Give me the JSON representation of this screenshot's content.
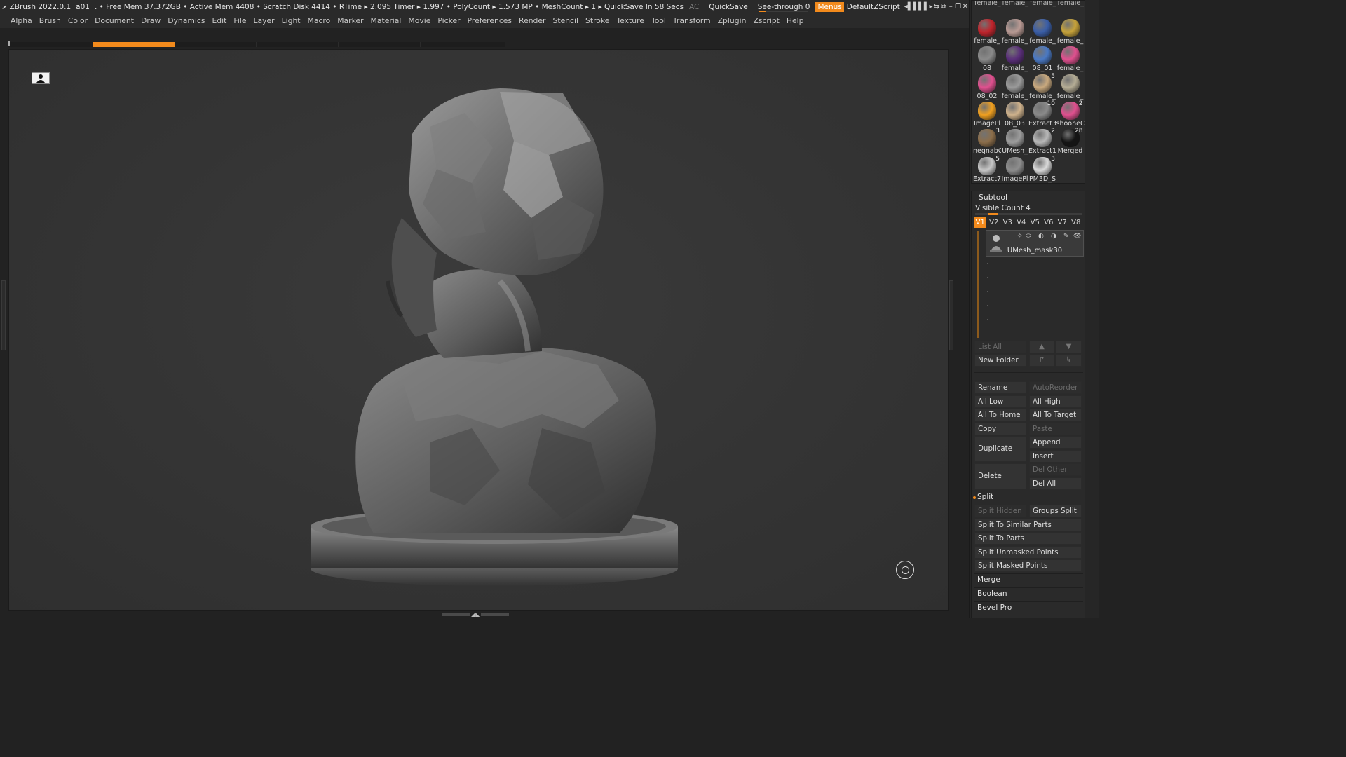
{
  "titlebar": {
    "app": "ZBrush 2022.0.1",
    "doc": "a01",
    "status": ". • Free Mem 37.372GB • Active Mem 4408 • Scratch Disk 4414 •  RTime ▸ 2.095 Timer ▸ 1.997 • PolyCount ▸ 1.573 MP  • MeshCount ▸ 1   ▸ QuickSave In 58 Secs",
    "ac": "AC",
    "quicksave": "QuickSave",
    "seethrough_label": "See-through",
    "seethrough_value": "0",
    "menus": "Menus",
    "script": "DefaultZScript"
  },
  "menubar": [
    "Alpha",
    "Brush",
    "Color",
    "Document",
    "Draw",
    "Dynamics",
    "Edit",
    "File",
    "Layer",
    "Light",
    "Macro",
    "Marker",
    "Material",
    "Movie",
    "Picker",
    "Preferences",
    "Render",
    "Stencil",
    "Stroke",
    "Texture",
    "Tool",
    "Transform",
    "Zplugin",
    "Zscript",
    "Help"
  ],
  "tools": [
    {
      "label": "female_",
      "color": "#c0242c",
      "count": ""
    },
    {
      "label": "female_",
      "color": "#b99a94",
      "count": ""
    },
    {
      "label": "female_",
      "color": "#3a5ea8",
      "count": ""
    },
    {
      "label": "female_",
      "color": "#c7a33a",
      "count": ""
    },
    {
      "label": "08",
      "color": "#8a8a8a",
      "count": ""
    },
    {
      "label": "female_",
      "color": "#5a2e7a",
      "count": ""
    },
    {
      "label": "08_01",
      "color": "#4a79c4",
      "count": ""
    },
    {
      "label": "female_",
      "color": "#e0508f",
      "count": ""
    },
    {
      "label": "08_02",
      "color": "#e0508f",
      "count": ""
    },
    {
      "label": "female_",
      "color": "#9a9a9a",
      "count": ""
    },
    {
      "label": "female_",
      "color": "#c9a97e",
      "count": "5"
    },
    {
      "label": "female_",
      "color": "#b5ad95",
      "count": ""
    },
    {
      "label": "ImagePl",
      "color": "#f0a020",
      "count": ""
    },
    {
      "label": "08_03",
      "color": "#cfb28c",
      "count": ""
    },
    {
      "label": "Extract3",
      "color": "#8a8a8a",
      "count": "10"
    },
    {
      "label": "shooneC",
      "color": "#e0508f",
      "count": "2"
    },
    {
      "label": "negnabC",
      "color": "#8c6e4a",
      "count": "3"
    },
    {
      "label": "UMesh_",
      "color": "#9c9c9c",
      "count": ""
    },
    {
      "label": "Extract1",
      "color": "#b8b8b8",
      "count": "2"
    },
    {
      "label": "Merged",
      "color": "#151515",
      "count": "28"
    },
    {
      "label": "Extract7",
      "color": "#c8c8c8",
      "count": "5"
    },
    {
      "label": "ImagePl",
      "color": "#8e8e8e",
      "count": ""
    },
    {
      "label": "PM3D_S",
      "color": "#dadada",
      "count": "3"
    }
  ],
  "subtool": {
    "title": "Subtool",
    "visible_count": "Visible Count 4",
    "views": [
      "V1",
      "V2",
      "V3",
      "V4",
      "V5",
      "V6",
      "V7",
      "V8"
    ],
    "active_view": "V1",
    "item_name": "UMesh_mask30",
    "list_all": "List All",
    "new_folder": "New Folder",
    "rename": "Rename",
    "autoreorder": "AutoReorder",
    "all_low": "All Low",
    "all_high": "All High",
    "all_to_home": "All To Home",
    "all_to_target": "All To Target",
    "copy": "Copy",
    "paste": "Paste",
    "duplicate": "Duplicate",
    "append": "Append",
    "insert": "Insert",
    "delete": "Delete",
    "del_other": "Del Other",
    "del_all": "Del All",
    "split": "Split",
    "split_hidden": "Split Hidden",
    "groups_split": "Groups Split",
    "split_similar": "Split To Similar Parts",
    "split_parts": "Split To Parts",
    "split_unmasked": "Split Unmasked Points",
    "split_masked": "Split Masked Points",
    "merge": "Merge",
    "boolean": "Boolean",
    "bevel_pro": "Bevel Pro"
  },
  "colors": {
    "accent": "#f28a1c",
    "panel": "#262626",
    "canvas": "#353535"
  }
}
